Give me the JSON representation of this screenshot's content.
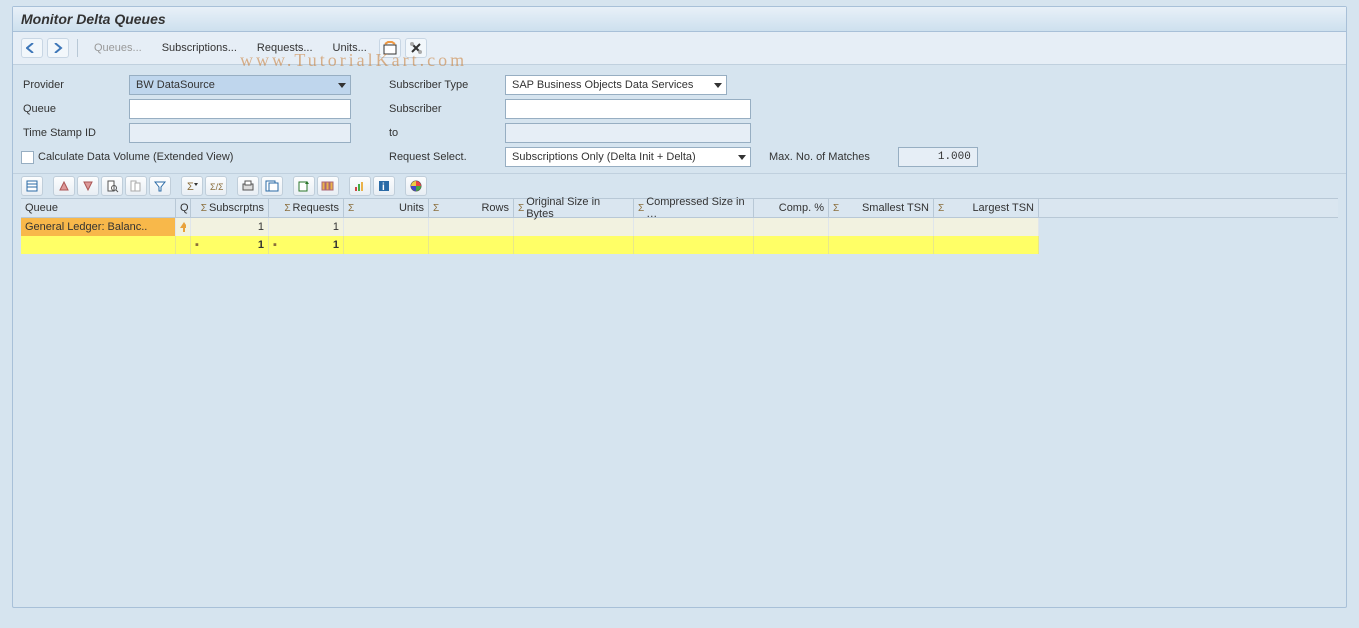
{
  "title": "Monitor Delta Queues",
  "watermark": "www.TutorialKart.com",
  "toolbar1": {
    "queues": "Queues...",
    "subscriptions": "Subscriptions...",
    "requests": "Requests...",
    "units": "Units..."
  },
  "criteria": {
    "labels": {
      "provider": "Provider",
      "queue": "Queue",
      "timestamp": "Time Stamp ID",
      "calc": "Calculate Data Volume (Extended View)",
      "sub_type": "Subscriber Type",
      "subscriber": "Subscriber",
      "to": "to",
      "req_sel": "Request Select.",
      "max_matches": "Max. No. of Matches"
    },
    "provider_value": "BW DataSource",
    "queue_value": "",
    "timestamp_value": "",
    "sub_type_value": "SAP Business Objects Data Services",
    "subscriber_value": "",
    "to_value": "",
    "req_sel_value": "Subscriptions Only (Delta Init + Delta)",
    "max_matches_value": "1.000"
  },
  "grid": {
    "headers": {
      "queue": "Queue",
      "q": "Q",
      "subscriptions": "Subscrptns",
      "requests": "Requests",
      "units": "Units",
      "rows": "Rows",
      "orig_size": "Original Size in Bytes",
      "comp_size": "Compressed Size in …",
      "comp_pct": "Comp. %",
      "smallest_tsn": "Smallest TSN",
      "largest_tsn": "Largest TSN"
    },
    "row": {
      "queue": "General Ledger: Balanc..",
      "q_icon": "up",
      "subscriptions": "1",
      "requests": "1",
      "units": "",
      "rows": "",
      "orig_size": "",
      "comp_size": "",
      "comp_pct": "",
      "smallest_tsn": "",
      "largest_tsn": ""
    },
    "totals": {
      "subscriptions": "1",
      "requests": "1"
    }
  }
}
